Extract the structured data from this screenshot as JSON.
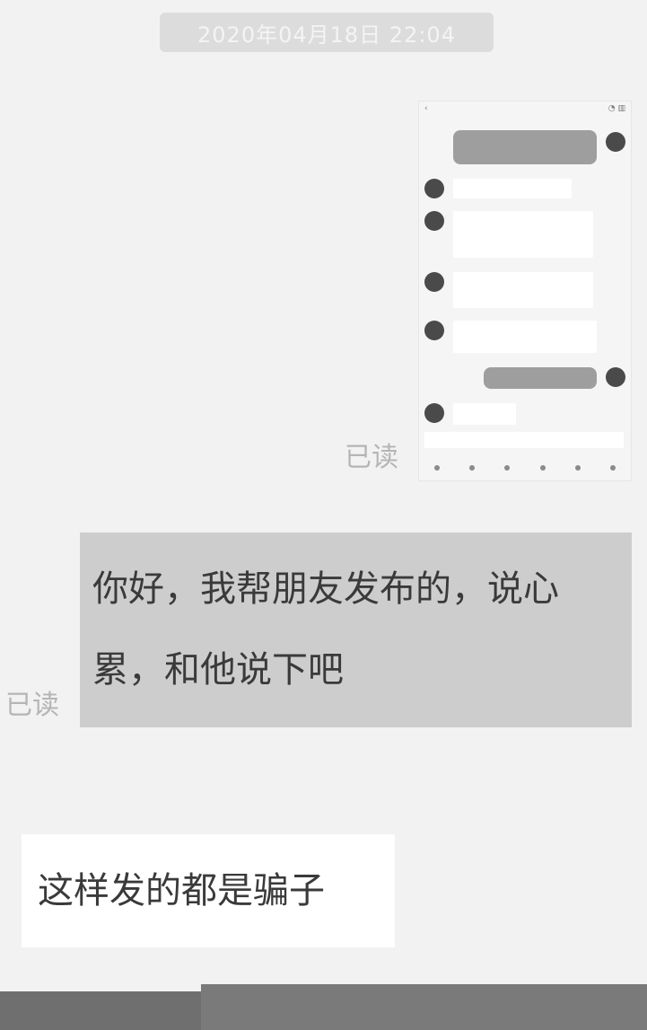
{
  "timestamp": "2020年04月18日 22:04",
  "read_status_1": "已读",
  "read_status_2": "已读",
  "outgoing_message": "你好，我帮朋友发布的，说心累，和他说下吧",
  "incoming_sender": "",
  "incoming_message": "这样发的都是骗子",
  "screenshot_image": {
    "status_left": "‹",
    "status_right": "◔ ▥",
    "messages": [
      {
        "side": "out",
        "text": ""
      },
      {
        "side": "in",
        "text": ""
      },
      {
        "side": "in",
        "text": ""
      },
      {
        "side": "in",
        "text": ""
      },
      {
        "side": "in",
        "text": ""
      },
      {
        "side": "out",
        "text": ""
      },
      {
        "side": "in",
        "text": ""
      }
    ]
  },
  "colors": {
    "background": "#f2f2f2",
    "outgoing_bubble": "#cdcdcd",
    "incoming_bubble": "#ffffff",
    "read_status": "#b5b5b5"
  }
}
